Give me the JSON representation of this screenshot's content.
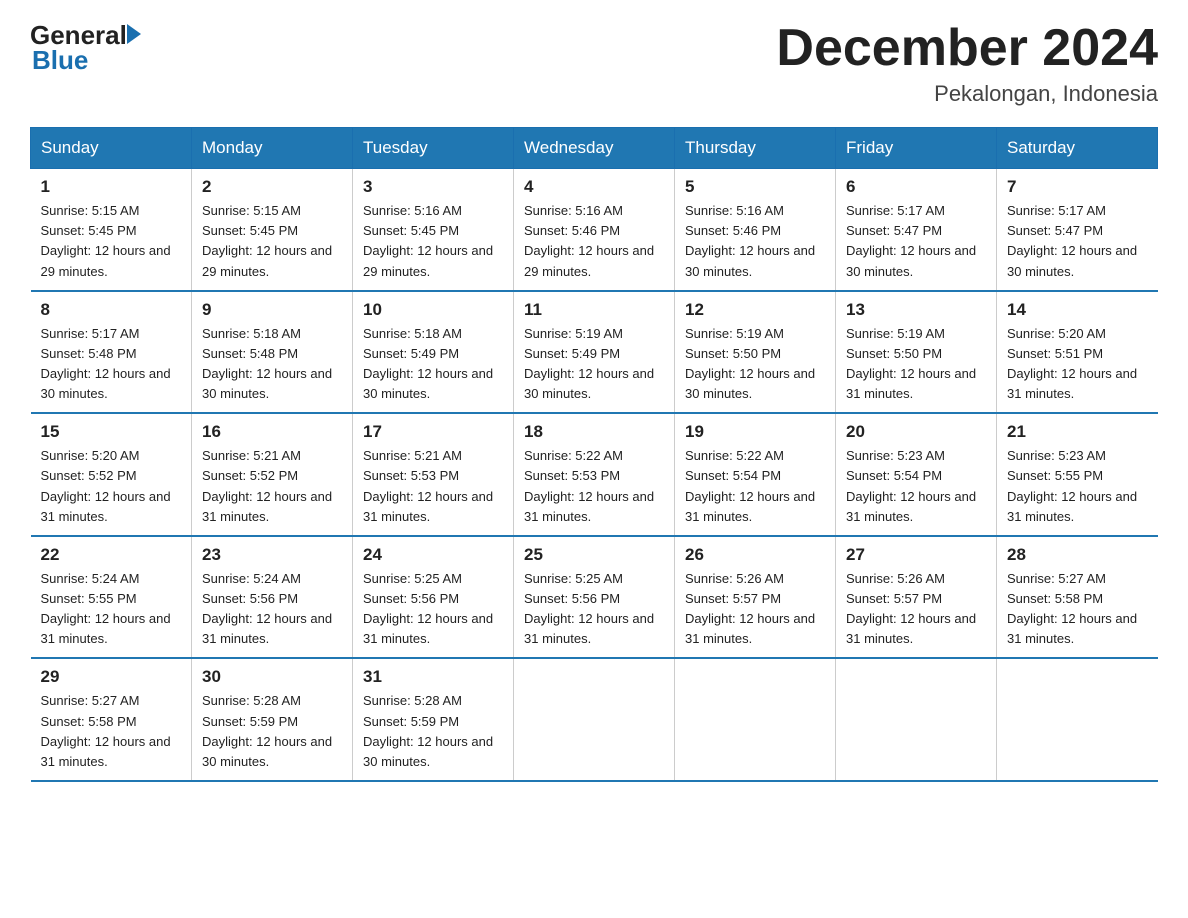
{
  "header": {
    "logo_general": "General",
    "logo_blue": "Blue",
    "title": "December 2024",
    "location": "Pekalongan, Indonesia"
  },
  "days_of_week": [
    "Sunday",
    "Monday",
    "Tuesday",
    "Wednesday",
    "Thursday",
    "Friday",
    "Saturday"
  ],
  "weeks": [
    [
      {
        "day": "1",
        "sunrise": "5:15 AM",
        "sunset": "5:45 PM",
        "daylight": "12 hours and 29 minutes."
      },
      {
        "day": "2",
        "sunrise": "5:15 AM",
        "sunset": "5:45 PM",
        "daylight": "12 hours and 29 minutes."
      },
      {
        "day": "3",
        "sunrise": "5:16 AM",
        "sunset": "5:45 PM",
        "daylight": "12 hours and 29 minutes."
      },
      {
        "day": "4",
        "sunrise": "5:16 AM",
        "sunset": "5:46 PM",
        "daylight": "12 hours and 29 minutes."
      },
      {
        "day": "5",
        "sunrise": "5:16 AM",
        "sunset": "5:46 PM",
        "daylight": "12 hours and 30 minutes."
      },
      {
        "day": "6",
        "sunrise": "5:17 AM",
        "sunset": "5:47 PM",
        "daylight": "12 hours and 30 minutes."
      },
      {
        "day": "7",
        "sunrise": "5:17 AM",
        "sunset": "5:47 PM",
        "daylight": "12 hours and 30 minutes."
      }
    ],
    [
      {
        "day": "8",
        "sunrise": "5:17 AM",
        "sunset": "5:48 PM",
        "daylight": "12 hours and 30 minutes."
      },
      {
        "day": "9",
        "sunrise": "5:18 AM",
        "sunset": "5:48 PM",
        "daylight": "12 hours and 30 minutes."
      },
      {
        "day": "10",
        "sunrise": "5:18 AM",
        "sunset": "5:49 PM",
        "daylight": "12 hours and 30 minutes."
      },
      {
        "day": "11",
        "sunrise": "5:19 AM",
        "sunset": "5:49 PM",
        "daylight": "12 hours and 30 minutes."
      },
      {
        "day": "12",
        "sunrise": "5:19 AM",
        "sunset": "5:50 PM",
        "daylight": "12 hours and 30 minutes."
      },
      {
        "day": "13",
        "sunrise": "5:19 AM",
        "sunset": "5:50 PM",
        "daylight": "12 hours and 31 minutes."
      },
      {
        "day": "14",
        "sunrise": "5:20 AM",
        "sunset": "5:51 PM",
        "daylight": "12 hours and 31 minutes."
      }
    ],
    [
      {
        "day": "15",
        "sunrise": "5:20 AM",
        "sunset": "5:52 PM",
        "daylight": "12 hours and 31 minutes."
      },
      {
        "day": "16",
        "sunrise": "5:21 AM",
        "sunset": "5:52 PM",
        "daylight": "12 hours and 31 minutes."
      },
      {
        "day": "17",
        "sunrise": "5:21 AM",
        "sunset": "5:53 PM",
        "daylight": "12 hours and 31 minutes."
      },
      {
        "day": "18",
        "sunrise": "5:22 AM",
        "sunset": "5:53 PM",
        "daylight": "12 hours and 31 minutes."
      },
      {
        "day": "19",
        "sunrise": "5:22 AM",
        "sunset": "5:54 PM",
        "daylight": "12 hours and 31 minutes."
      },
      {
        "day": "20",
        "sunrise": "5:23 AM",
        "sunset": "5:54 PM",
        "daylight": "12 hours and 31 minutes."
      },
      {
        "day": "21",
        "sunrise": "5:23 AM",
        "sunset": "5:55 PM",
        "daylight": "12 hours and 31 minutes."
      }
    ],
    [
      {
        "day": "22",
        "sunrise": "5:24 AM",
        "sunset": "5:55 PM",
        "daylight": "12 hours and 31 minutes."
      },
      {
        "day": "23",
        "sunrise": "5:24 AM",
        "sunset": "5:56 PM",
        "daylight": "12 hours and 31 minutes."
      },
      {
        "day": "24",
        "sunrise": "5:25 AM",
        "sunset": "5:56 PM",
        "daylight": "12 hours and 31 minutes."
      },
      {
        "day": "25",
        "sunrise": "5:25 AM",
        "sunset": "5:56 PM",
        "daylight": "12 hours and 31 minutes."
      },
      {
        "day": "26",
        "sunrise": "5:26 AM",
        "sunset": "5:57 PM",
        "daylight": "12 hours and 31 minutes."
      },
      {
        "day": "27",
        "sunrise": "5:26 AM",
        "sunset": "5:57 PM",
        "daylight": "12 hours and 31 minutes."
      },
      {
        "day": "28",
        "sunrise": "5:27 AM",
        "sunset": "5:58 PM",
        "daylight": "12 hours and 31 minutes."
      }
    ],
    [
      {
        "day": "29",
        "sunrise": "5:27 AM",
        "sunset": "5:58 PM",
        "daylight": "12 hours and 31 minutes."
      },
      {
        "day": "30",
        "sunrise": "5:28 AM",
        "sunset": "5:59 PM",
        "daylight": "12 hours and 30 minutes."
      },
      {
        "day": "31",
        "sunrise": "5:28 AM",
        "sunset": "5:59 PM",
        "daylight": "12 hours and 30 minutes."
      },
      null,
      null,
      null,
      null
    ]
  ],
  "labels": {
    "sunrise": "Sunrise: ",
    "sunset": "Sunset: ",
    "daylight": "Daylight: "
  }
}
